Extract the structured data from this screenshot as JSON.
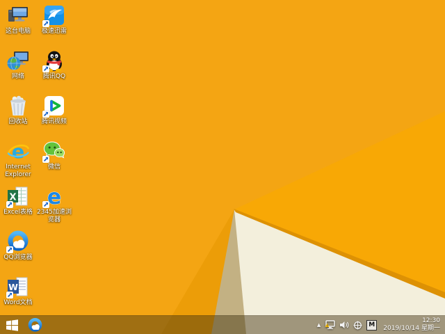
{
  "wallpaper": {
    "base_color": "#F4A513",
    "bright_facet_color": "#F8A805",
    "shadow_facet_color": "#EC9D08",
    "tan_facet_color": "#C3B183",
    "cream_facet_color": "#F3EFDC",
    "fold_edge_color": "#DD9104"
  },
  "desktop": {
    "icons": [
      {
        "label": "这台电脑",
        "icon": "this-pc",
        "shortcut": false
      },
      {
        "label": "极速迅雷",
        "icon": "xunlei",
        "shortcut": true
      },
      {
        "label": "网络",
        "icon": "network",
        "shortcut": false
      },
      {
        "label": "腾讯QQ",
        "icon": "tencent-qq",
        "shortcut": true
      },
      {
        "label": "回收站",
        "icon": "recycle-bin",
        "shortcut": false
      },
      {
        "label": "腾讯视频",
        "icon": "tencent-video",
        "shortcut": true
      },
      {
        "label": "Internet Explorer",
        "icon": "internet-explorer",
        "shortcut": false
      },
      {
        "label": "微信",
        "icon": "wechat",
        "shortcut": true
      },
      {
        "label": "Excel表格",
        "icon": "excel",
        "shortcut": true
      },
      {
        "label": "2345加速浏览器",
        "icon": "2345-browser",
        "shortcut": true
      },
      {
        "label": "QQ浏览器",
        "icon": "qq-browser",
        "shortcut": true
      },
      {
        "label": "Word文档",
        "icon": "word",
        "shortcut": true
      }
    ]
  },
  "taskbar": {
    "tint_color": "rgba(66,51,17,0.47)",
    "pinned_icons": [
      "windows-start",
      "qq-browser"
    ],
    "tray": {
      "icons": [
        "hidden-icons-expand",
        "network-warning",
        "volume",
        "crosshair",
        "ime-indicator"
      ],
      "ime_indicator": "M",
      "clock_time": "12:30",
      "clock_date": "2019/10/14 星期一"
    }
  }
}
